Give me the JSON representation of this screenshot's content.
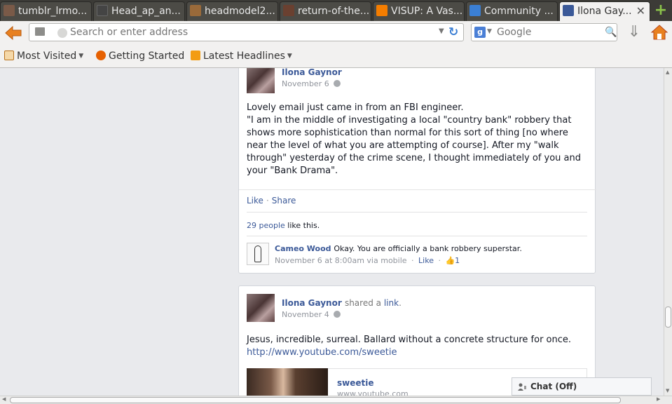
{
  "browser": {
    "tabs": [
      {
        "label": "tumblr_lrmo...",
        "icon": "tumblr-thumbnail-icon",
        "color": "#7a5a48"
      },
      {
        "label": "Head_ap_an...",
        "icon": "image-thumbnail-icon",
        "color": "#444"
      },
      {
        "label": "headmodel2...",
        "icon": "image-thumbnail-icon",
        "color": "#9a6a3a"
      },
      {
        "label": "return-of-the...",
        "icon": "image-thumbnail-icon",
        "color": "#6a4030"
      },
      {
        "label": "VISUP: A Vas...",
        "icon": "blogger-icon",
        "color": "#f57d00"
      },
      {
        "label": "Community ...",
        "icon": "community-icon",
        "color": "#3b7fd4"
      },
      {
        "label": "Ilona Gay...",
        "icon": "facebook-icon",
        "color": "#3b5998",
        "active": true
      }
    ],
    "url_placeholder": "Search or enter address",
    "search_placeholder": "Google",
    "search_engine_letter": "g",
    "bookmarks": [
      {
        "label": "Most Visited",
        "icon": "bookmarks-folder-icon",
        "dropdown": true
      },
      {
        "label": "Getting Started",
        "icon": "firefox-icon",
        "dropdown": false
      },
      {
        "label": "Latest Headlines",
        "icon": "rss-feed-icon",
        "dropdown": true
      }
    ]
  },
  "post1": {
    "author": "Ilona Gaynor",
    "date": "November 6",
    "body": [
      "Lovely email just came in from an FBI engineer.",
      "\"I am in the middle of investigating a local \"country bank\" robbery that shows more sophistication than normal for this sort of thing [no where near the level of what you are attempting of course]. After my \"walk through\" yesterday of the crime scene, I thought immediately of you and your \"Bank Drama\"."
    ],
    "like": "Like",
    "share": "Share",
    "separator": "·",
    "likes_count": "29 people",
    "likes_suffix": "like this.",
    "comment": {
      "author": "Cameo Wood",
      "text": "Okay. You are officially a bank robbery superstar.",
      "meta": "November 6 at 8:00am via mobile",
      "like": "Like",
      "like_count": "1"
    }
  },
  "post2": {
    "author": "Ilona Gaynor",
    "shared": "shared a",
    "link_word": "link",
    "period": ".",
    "date": "November 4",
    "body": "Jesus, incredible, surreal. Ballard without a concrete structure for once.",
    "url": "http://www.youtube.com/sweetie",
    "preview_title": "sweetie",
    "preview_domain": "www.youtube.com"
  },
  "chat": {
    "label": "Chat (Off)"
  }
}
